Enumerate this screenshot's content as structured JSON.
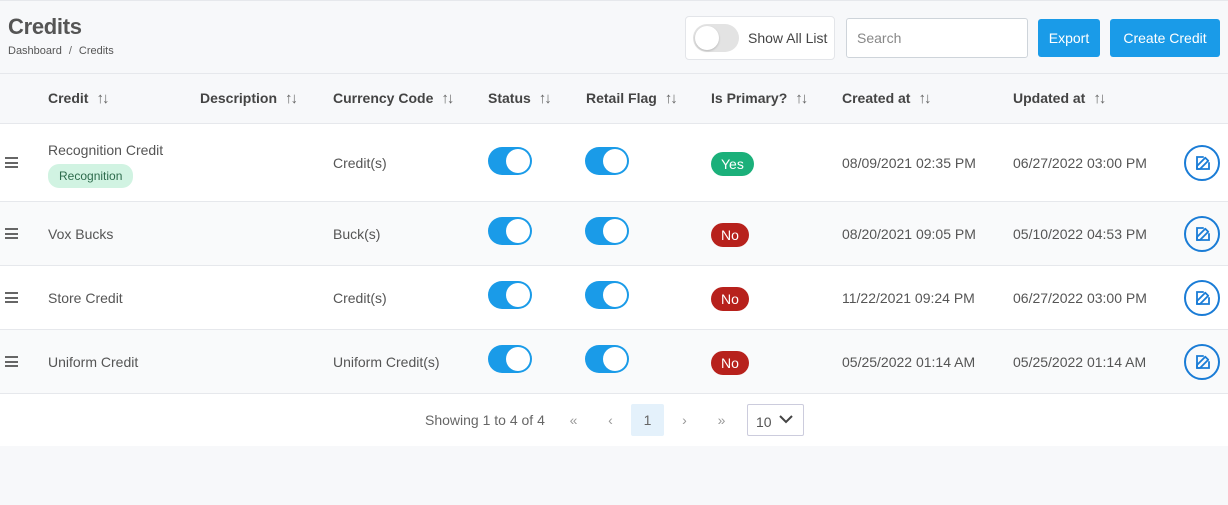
{
  "header": {
    "title": "Credits",
    "breadcrumb": [
      "Dashboard",
      "Credits"
    ],
    "breadcrumb_sep": "/",
    "show_all_label": "Show All List",
    "search_placeholder": "Search",
    "export_label": "Export",
    "create_label": "Create Credit"
  },
  "table": {
    "columns": [
      "Credit",
      "Description",
      "Currency Code",
      "Status",
      "Retail Flag",
      "Is Primary?",
      "Created at",
      "Updated at"
    ],
    "sort_glyph": "↑↓",
    "rows": [
      {
        "credit": "Recognition Credit",
        "tag": "Recognition",
        "currency": "Credit(s)",
        "status_on": true,
        "retail_on": true,
        "primary": "Yes",
        "created": "08/09/2021 02:35 PM",
        "updated": "06/27/2022 03:00 PM"
      },
      {
        "credit": "Vox Bucks",
        "currency": "Buck(s)",
        "status_on": true,
        "retail_on": true,
        "primary": "No",
        "created": "08/20/2021 09:05 PM",
        "updated": "05/10/2022 04:53 PM"
      },
      {
        "credit": "Store Credit",
        "currency": "Credit(s)",
        "status_on": true,
        "retail_on": true,
        "primary": "No",
        "created": "11/22/2021 09:24 PM",
        "updated": "06/27/2022 03:00 PM"
      },
      {
        "credit": "Uniform Credit",
        "currency": "Uniform Credit(s)",
        "status_on": true,
        "retail_on": true,
        "primary": "No",
        "created": "05/25/2022 01:14 AM",
        "updated": "05/25/2022 01:14 AM"
      }
    ]
  },
  "pagination": {
    "info": "Showing 1 to 4 of 4",
    "first": "«",
    "prev": "‹",
    "current": "1",
    "next": "›",
    "last": "»",
    "per_page": "10"
  },
  "colors": {
    "accent": "#1a9be8",
    "yes": "#1bb07a",
    "no": "#b7211c"
  }
}
